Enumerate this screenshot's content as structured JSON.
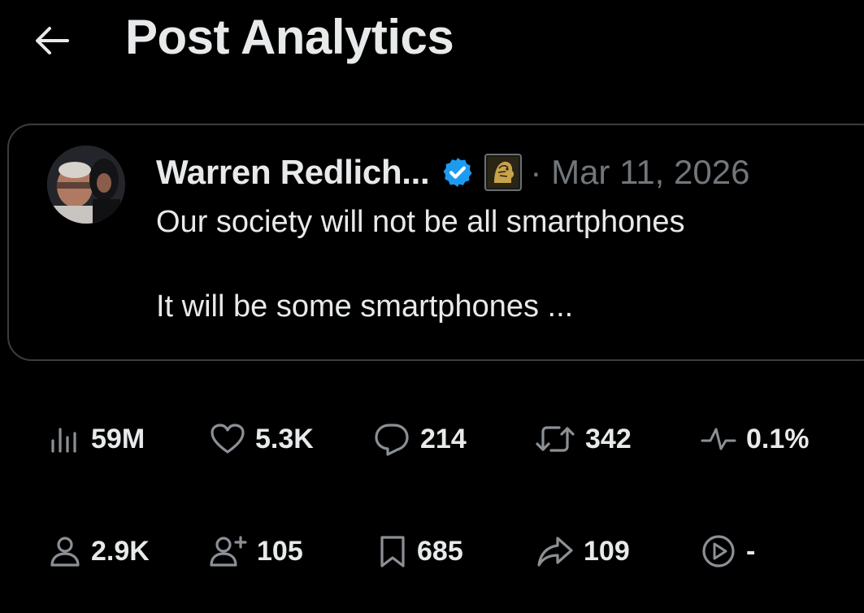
{
  "header": {
    "title": "Post Analytics",
    "back_icon": "arrow-left-icon"
  },
  "post": {
    "author": "Warren Redlich...",
    "date": "Mar 11, 2026",
    "line1": "Our society will not be all smartphones",
    "line2": "It will be some smartphones ...",
    "verified_color": "#1d9bf0",
    "affiliation_icon": "lion-badge-icon"
  },
  "metrics": {
    "row1": [
      {
        "icon": "views-chart-icon",
        "value": "59M"
      },
      {
        "icon": "heart-icon",
        "value": "5.3K"
      },
      {
        "icon": "reply-bubble-icon",
        "value": "214"
      },
      {
        "icon": "repost-icon",
        "value": "342"
      },
      {
        "icon": "engagement-pulse-icon",
        "value": "0.1%"
      }
    ],
    "row2": [
      {
        "icon": "profile-visit-icon",
        "value": "2.9K"
      },
      {
        "icon": "follow-icon",
        "value": "105"
      },
      {
        "icon": "bookmark-icon",
        "value": "685"
      },
      {
        "icon": "share-icon",
        "value": "109"
      },
      {
        "icon": "video-play-icon",
        "value": "-"
      }
    ]
  },
  "colors": {
    "background": "#000000",
    "text": "#e7e9ea",
    "muted": "#71767b",
    "border": "#3a3d40"
  }
}
